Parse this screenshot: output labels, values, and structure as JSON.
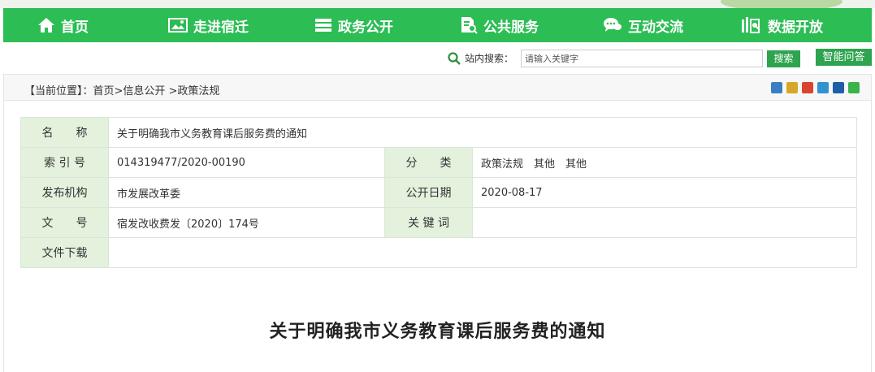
{
  "nav": {
    "items": [
      {
        "label": "首页",
        "icon": "home-icon"
      },
      {
        "label": "走进宿迁",
        "icon": "picture-icon"
      },
      {
        "label": "政务公开",
        "icon": "list-icon"
      },
      {
        "label": "公共服务",
        "icon": "document-search-icon"
      },
      {
        "label": "互动交流",
        "icon": "chat-icon"
      },
      {
        "label": "数据开放",
        "icon": "data-icon"
      }
    ],
    "background": "#2dbd55"
  },
  "search": {
    "label": "站内搜索：",
    "placeholder": "请输入关键字",
    "button_label": "搜索",
    "qa_label": "智能问答"
  },
  "breadcrumb": {
    "text": "【当前位置】：首页>信息公开 >政策法规"
  },
  "share_icons": [
    "plus-share-icon",
    "star-share-icon",
    "weibo-share-icon",
    "qzone-share-icon",
    "renren-share-icon",
    "wechat-share-icon"
  ],
  "info": {
    "name_label": "名　　称",
    "name_value": "关于明确我市义务教育课后服务费的通知",
    "index_label": "索 引 号",
    "index_value": "014319477/2020-00190",
    "category_label": "分　　类",
    "category_value": "政策法规　其他　其他",
    "publisher_label": "发布机构",
    "publisher_value": "市发展改革委",
    "date_label": "公开日期",
    "date_value": "2020-08-17",
    "docno_label": "文　　号",
    "docno_value": "宿发改收费发〔2020〕174号",
    "keyword_label": "关 键 词",
    "keyword_value": "",
    "download_label": "文件下载",
    "download_value": ""
  },
  "document": {
    "title": "关于明确我市义务教育课后服务费的通知"
  },
  "colors": {
    "accent": "#2dbd55",
    "label_bg": "#e3f1dd",
    "button": "#2ea44f"
  }
}
